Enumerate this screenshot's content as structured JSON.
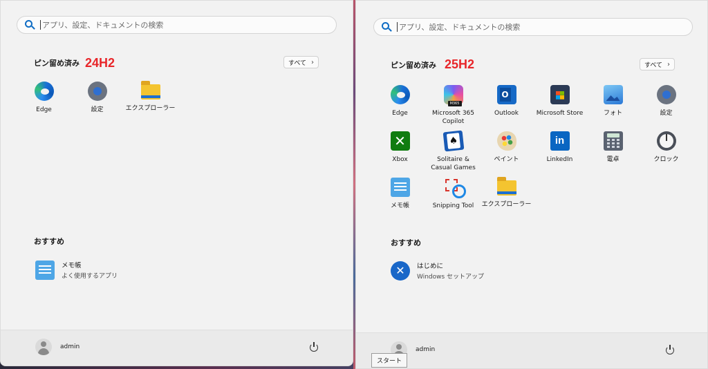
{
  "search_placeholder": "アプリ、設定、ドキュメントの検索",
  "left": {
    "pinned_title": "ピン留め済み",
    "version": "24H2",
    "all_label": "すべて",
    "pinned_apps": [
      {
        "label": "Edge",
        "icon": "edge-icon"
      },
      {
        "label": "設定",
        "icon": "settings-gear-icon"
      },
      {
        "label": "エクスプローラー",
        "icon": "file-explorer-folder-icon"
      }
    ],
    "recommended_title": "おすすめ",
    "recommended": [
      {
        "title": "メモ帳",
        "subtitle": "よく使用するアプリ",
        "icon": "notepad-icon"
      }
    ],
    "user_name": "admin"
  },
  "right": {
    "pinned_title": "ピン留め済み",
    "version": "25H2",
    "all_label": "すべて",
    "pinned_apps": [
      {
        "label": "Edge",
        "icon": "edge-icon"
      },
      {
        "label": "Microsoft 365\nCopilot",
        "icon": "m365-copilot-icon",
        "badge": "M365"
      },
      {
        "label": "Outlook",
        "icon": "outlook-icon"
      },
      {
        "label": "Microsoft Store",
        "icon": "store-icon"
      },
      {
        "label": "フォト",
        "icon": "photos-icon"
      },
      {
        "label": "設定",
        "icon": "settings-gear-icon"
      },
      {
        "label": "Xbox",
        "icon": "xbox-icon"
      },
      {
        "label": "Solitaire &\nCasual Games",
        "icon": "solitaire-icon"
      },
      {
        "label": "ペイント",
        "icon": "paint-icon"
      },
      {
        "label": "LinkedIn",
        "icon": "linkedin-icon"
      },
      {
        "label": "電卓",
        "icon": "calculator-icon"
      },
      {
        "label": "クロック",
        "icon": "clock-icon"
      },
      {
        "label": "メモ帳",
        "icon": "notepad-icon"
      },
      {
        "label": "Snipping Tool",
        "icon": "snipping-tool-icon"
      },
      {
        "label": "エクスプローラー",
        "icon": "file-explorer-folder-icon"
      }
    ],
    "recommended_title": "おすすめ",
    "recommended": [
      {
        "title": "はじめに",
        "subtitle": "Windows セットアップ",
        "icon": "get-started-icon"
      }
    ],
    "user_name": "admin"
  },
  "tooltip": "スタート",
  "colors": {
    "version_tag": "#e8262a",
    "panel_bg": "#f2f2f2",
    "accent": "#0e6cc4"
  }
}
